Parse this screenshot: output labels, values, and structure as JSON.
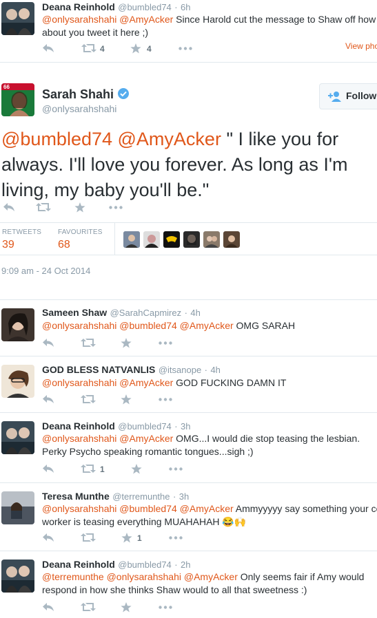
{
  "top_reply": {
    "name": "Deana Reinhold",
    "handle": "@bumbled74",
    "time": "6h",
    "mentions": "@onlysarahshahi @AmyAcker",
    "text_line1": " Since Harold cut the message to Shaw off how",
    "text_line2": "about you tweet it here  ;)",
    "retweet_count": "4",
    "favorite_count": "4",
    "view_photo": "View pho"
  },
  "main_tweet": {
    "name": "Sarah Shahi",
    "handle": "@onlysarahshahi",
    "follow_label": "Follow",
    "mentions": "@bumbled74 @AmyAcker",
    "text_line1": " \" I like you for",
    "text_line2": "always. I'll love you forever. As long as I'm",
    "text_line3": "living, my baby you'll be.\"",
    "retweets_label": "RETWEETS",
    "retweets_count": "39",
    "favourites_label": "FAVOURITES",
    "favourites_count": "68",
    "timestamp": "9:09 am - 24 Oct 2014"
  },
  "replies": [
    {
      "name": "Sameen Shaw",
      "handle": "@SarahCapmirez",
      "time": "4h",
      "mentions": "@onlysarahshahi @bumbled74 @AmyAcker",
      "text_line1": " OMG SARAH",
      "text_line2": "",
      "retweet_count": "",
      "favorite_count": ""
    },
    {
      "name": "GOD BLESS NATVANLIS",
      "handle": "@itsanope",
      "time": "4h",
      "mentions": "@onlysarahshahi @AmyAcker",
      "text_line1": " GOD FUCKING DAMN IT",
      "text_line2": "",
      "retweet_count": "",
      "favorite_count": ""
    },
    {
      "name": "Deana Reinhold",
      "handle": "@bumbled74",
      "time": "3h",
      "mentions": "@onlysarahshahi @AmyAcker",
      "text_line1": " OMG...I would die stop teasing the lesbian.",
      "text_line2": "Perky Psycho speaking romantic tongues...sigh  ;)",
      "retweet_count": "1",
      "favorite_count": ""
    },
    {
      "name": "Teresa Munthe",
      "handle": "@terremunthe",
      "time": "3h",
      "mentions": "@onlysarahshahi @bumbled74 @AmyAcker",
      "text_line1": " Ammyyyyy say something your co",
      "text_line2": "worker is teasing everything MUAHAHAH 😂🙌",
      "retweet_count": "",
      "favorite_count": "1"
    },
    {
      "name": "Deana Reinhold",
      "handle": "@bumbled74",
      "time": "2h",
      "mentions": "@terremunthe @onlysarahshahi @AmyAcker",
      "text_line1": " Only seems fair if Amy would",
      "text_line2": "respond in how she thinks Shaw would to all that sweetness :)",
      "retweet_count": "",
      "favorite_count": ""
    }
  ],
  "colors": {
    "link": "#e0571a",
    "muted": "#8899a6",
    "action_icon": "#aab8c2",
    "verified": "#55acee",
    "divider": "#e1e8ed"
  }
}
